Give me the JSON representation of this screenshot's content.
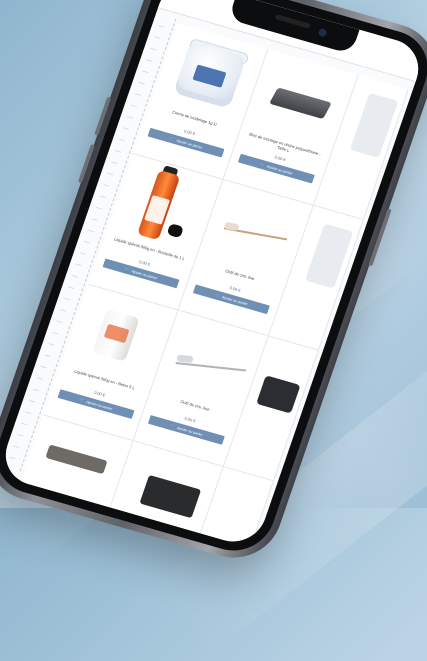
{
  "colors": {
    "accent": "#6f8fb4",
    "price": "#5a6f8f"
  },
  "products": [
    {
      "name": "Crème de modelage 1g 1l",
      "price": "0,00 €",
      "cart": "Ajouter au panier",
      "art": "jar"
    },
    {
      "name": "Bloc de moulage en résine polyuréthane - Taille L",
      "price": "0,00 €",
      "cart": "Ajouter au panier",
      "art": "tray"
    },
    {
      "name": "",
      "price": "",
      "cart": "",
      "art": "slab"
    },
    {
      "name": "Liquide spécial 500g en - Bouteille de 1 L",
      "price": "0,00 €",
      "cart": "Ajouter au panier",
      "art": "bottle"
    },
    {
      "name": "Outil de cire, fine",
      "price": "0,00 €",
      "cart": "Ajouter au panier",
      "art": "wire"
    },
    {
      "name": "",
      "price": "",
      "cart": "",
      "art": "slab"
    },
    {
      "name": "Liquide spécial 500g en - Bidon 5 L",
      "price": "0,00 €",
      "cart": "Ajouter au panier",
      "art": "tub"
    },
    {
      "name": "Outil de cire, fine",
      "price": "0,00 €",
      "cart": "Ajouter au panier",
      "art": "probe"
    },
    {
      "name": "",
      "price": "",
      "cart": "",
      "art": "device"
    },
    {
      "name": "",
      "price": "",
      "cart": "",
      "art": "grey"
    },
    {
      "name": "",
      "price": "",
      "cart": "",
      "art": "dark"
    },
    {
      "name": "",
      "price": "",
      "cart": "",
      "art": "none"
    }
  ]
}
